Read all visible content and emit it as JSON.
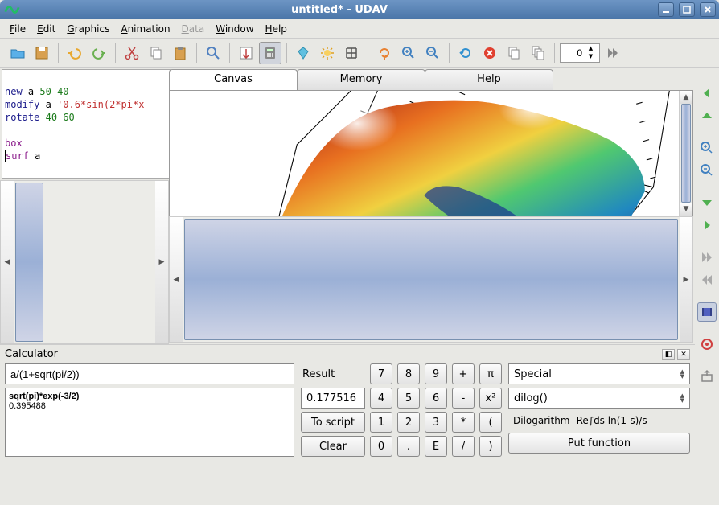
{
  "window": {
    "title": "untitled* - UDAV"
  },
  "menus": {
    "file": "File",
    "edit": "Edit",
    "graphics": "Graphics",
    "animation": "Animation",
    "data": "Data",
    "window": "Window",
    "help": "Help"
  },
  "toolbar": {
    "open": "open-icon",
    "save": "save-icon",
    "undo": "undo-icon",
    "redo": "redo-icon",
    "cut": "cut-icon",
    "copy": "copy-icon",
    "paste": "paste-icon",
    "find": "find-icon",
    "run": "run-icon",
    "grid_calc": "calculator-icon",
    "diamond": "diamond-icon",
    "sun": "sun-icon",
    "hash": "grid-icon",
    "restore": "restore-icon",
    "zoomin": "zoom-in-icon",
    "zoomout": "zoom-out-icon",
    "reload": "reload-icon",
    "stop": "stop-icon",
    "copy2": "copy-frame-icon",
    "copy3": "copy-all-icon",
    "spin_value": "0"
  },
  "code": {
    "line1_kw": "new",
    "line1_id": "a",
    "line1_n1": "50",
    "line1_n2": "40",
    "line2_kw": "modify",
    "line2_id": "a",
    "line2_str": "'0.6*sin(2*pi*x",
    "line3_kw": "rotate",
    "line3_n1": "40",
    "line3_n2": "60",
    "line4_kw": "box",
    "line5_kw": "surf",
    "line5_id": "a"
  },
  "tabs": {
    "canvas": "Canvas",
    "memory": "Memory",
    "help": "Help"
  },
  "calculator": {
    "title": "Calculator",
    "input": "a/(1+sqrt(pi/2))",
    "history_expr": "sqrt(pi)*exp(-3/2)",
    "history_result": "0.395488",
    "result_label": "Result",
    "result_value": "0.177516",
    "to_script": "To script",
    "clear": "Clear",
    "special_label": "Special",
    "func_label": "dilog()",
    "func_desc": "Dilogarithm -Re∫ds ln(1-s)/s",
    "put_function": "Put function",
    "b7": "7",
    "b8": "8",
    "b9": "9",
    "bplus": "+",
    "bpi": "π",
    "b4": "4",
    "b5": "5",
    "b6": "6",
    "bminus": "-",
    "bsq": "x²",
    "b1": "1",
    "b2": "2",
    "b3": "3",
    "bmul": "*",
    "bpar": "(",
    "b0": "0",
    "bdot": ".",
    "bE": "E",
    "bdiv": "/",
    "brpar": ")"
  },
  "right_toolbar": {
    "rot_left": "rotate-left-icon",
    "rot_up": "rotate-up-icon",
    "zoom_in": "zoom-in-icon",
    "zoom_out": "zoom-out-icon",
    "move_down": "move-down-icon",
    "move_right": "move-right-icon",
    "next": "next-frame-icon",
    "prev": "prev-frame-icon",
    "movie": "film-icon",
    "target": "target-icon",
    "export": "export-icon"
  },
  "chart_data": {
    "type": "surface3d",
    "variable": "a",
    "grid": {
      "nx": 50,
      "ny": 40
    },
    "formula": "0.6*sin(2*pi*x)",
    "rotation": {
      "theta": 40,
      "phi": 60
    },
    "box": true,
    "colormap": "default-rainbow",
    "zrange_approx": [
      -0.6,
      0.6
    ]
  }
}
